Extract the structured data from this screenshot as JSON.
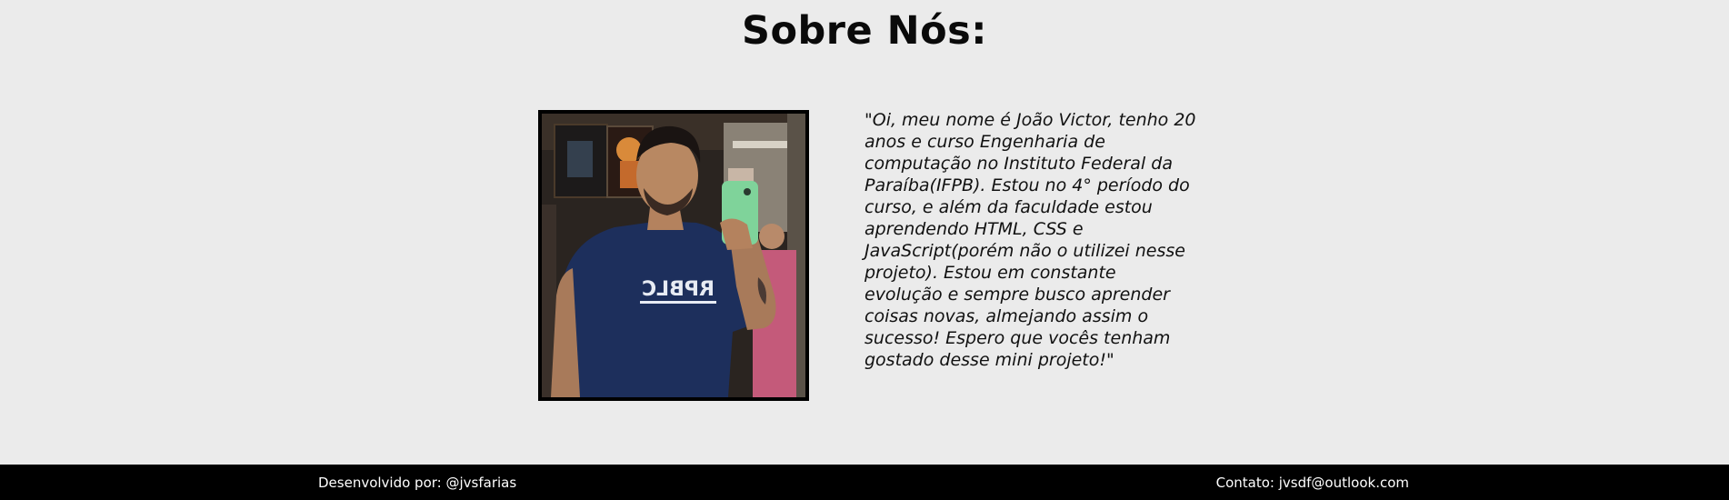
{
  "page": {
    "title": "Sobre Nós:"
  },
  "profile": {
    "photo_alt": "Foto de João Victor",
    "shirt_text": "RPBLC",
    "bio": "\"Oi, meu nome é João Victor, tenho 20 anos e curso Engenharia de computação no Instituto Federal da Paraíba(IFPB). Estou no 4° período do curso, e além da faculdade estou aprendendo HTML, CSS e JavaScript(porém não o utilizei nesse projeto). Estou em constante evolução e sempre busco aprender coisas novas, almejando assim o sucesso! Espero que vocês tenham gostado desse mini projeto!\""
  },
  "footer": {
    "developer": "Desenvolvido por: @jvsfarias",
    "contact": "Contato: jvsdf@outlook.com"
  },
  "colors": {
    "background": "#ebebeb",
    "footer_background": "#000000",
    "footer_text": "#ffffff",
    "shirt": "#1d2f5c",
    "phone": "#7fd39a"
  }
}
